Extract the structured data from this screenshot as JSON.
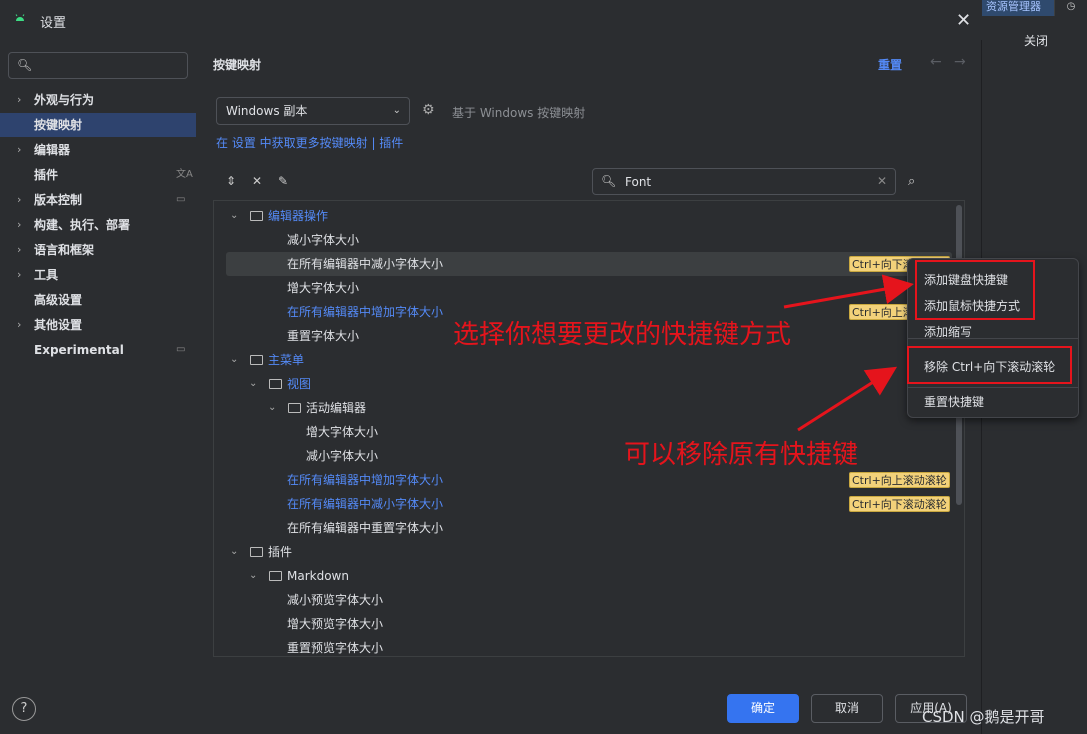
{
  "background": {
    "tab_label": "资源管理器",
    "close_label": "关闭"
  },
  "dialog": {
    "title": "设置"
  },
  "sidebar": {
    "search_placeholder": "",
    "items": [
      {
        "label": "外观与行为",
        "expandable": true,
        "selected": false
      },
      {
        "label": "按键映射",
        "expandable": false,
        "selected": true
      },
      {
        "label": "编辑器",
        "expandable": true,
        "selected": false
      },
      {
        "label": "插件",
        "expandable": false,
        "selected": false,
        "right_icon": "translate-icon"
      },
      {
        "label": "版本控制",
        "expandable": true,
        "selected": false,
        "right_icon": "window-icon"
      },
      {
        "label": "构建、执行、部署",
        "expandable": true,
        "selected": false
      },
      {
        "label": "语言和框架",
        "expandable": true,
        "selected": false
      },
      {
        "label": "工具",
        "expandable": true,
        "selected": false
      },
      {
        "label": "高级设置",
        "expandable": false,
        "selected": false
      },
      {
        "label": "其他设置",
        "expandable": true,
        "selected": false
      },
      {
        "label": "Experimental",
        "expandable": false,
        "selected": false,
        "right_icon": "window-icon"
      }
    ]
  },
  "main": {
    "title": "按键映射",
    "reset_label": "重置",
    "keymap_select_value": "Windows 副本",
    "keymap_base_text": "基于 Windows 按键映射",
    "more_keymaps_text": "在 设置 中获取更多按键映射 | 插件",
    "search_value": "Font",
    "tree": [
      {
        "label": "编辑器操作",
        "level": 0,
        "type": "folder",
        "expanded": true,
        "blue": true
      },
      {
        "label": "减小字体大小",
        "level": 1,
        "type": "action"
      },
      {
        "label": "在所有编辑器中减小字体大小",
        "level": 1,
        "type": "action",
        "selected": true,
        "shortcut": "Ctrl+向下滚动滚轮"
      },
      {
        "label": "增大字体大小",
        "level": 1,
        "type": "action"
      },
      {
        "label": "在所有编辑器中增加字体大小",
        "level": 1,
        "type": "action",
        "blue": true,
        "shortcut": "Ctrl+向上滚动滚轮"
      },
      {
        "label": "重置字体大小",
        "level": 1,
        "type": "action"
      },
      {
        "label": "主菜单",
        "level": 0,
        "type": "folder",
        "expanded": true,
        "blue": true
      },
      {
        "label": "视图",
        "level": 1,
        "type": "folder",
        "expanded": true,
        "blue": true
      },
      {
        "label": "活动编辑器",
        "level": 2,
        "type": "folder",
        "expanded": true
      },
      {
        "label": "增大字体大小",
        "level": 3,
        "type": "action"
      },
      {
        "label": "减小字体大小",
        "level": 3,
        "type": "action"
      },
      {
        "label": "在所有编辑器中增加字体大小",
        "level": 2,
        "type": "action",
        "blue": true,
        "shortcut": "Ctrl+向上滚动滚轮"
      },
      {
        "label": "在所有编辑器中减小字体大小",
        "level": 2,
        "type": "action",
        "blue": true,
        "shortcut": "Ctrl+向下滚动滚轮"
      },
      {
        "label": "在所有编辑器中重置字体大小",
        "level": 2,
        "type": "action"
      },
      {
        "label": "插件",
        "level": 0,
        "type": "folder",
        "expanded": true
      },
      {
        "label": "Markdown",
        "level": 1,
        "type": "folder",
        "expanded": true
      },
      {
        "label": "减小预览字体大小",
        "level": 2,
        "type": "action"
      },
      {
        "label": "增大预览字体大小",
        "level": 2,
        "type": "action"
      },
      {
        "label": "重置预览字体大小",
        "level": 2,
        "type": "action"
      }
    ]
  },
  "context_menu": {
    "items": [
      {
        "label": "添加键盘快捷键"
      },
      {
        "label": "添加鼠标快捷方式"
      },
      {
        "label": "添加缩写"
      },
      {
        "label": "移除 Ctrl+向下滚动滚轮"
      },
      {
        "label": "重置快捷键"
      }
    ]
  },
  "buttons": {
    "ok": "确定",
    "cancel": "取消",
    "apply": "应用(A)",
    "help": "?"
  },
  "annotations": {
    "choose": "选择你想要更改的快捷键方式",
    "remove": "可以移除原有快捷键"
  },
  "watermark": "CSDN @鹅是开哥",
  "colors": {
    "accent": "#3574f0",
    "link": "#548af7",
    "annotation": "#e5141c",
    "shortcut_badge": "#f3d27a"
  }
}
